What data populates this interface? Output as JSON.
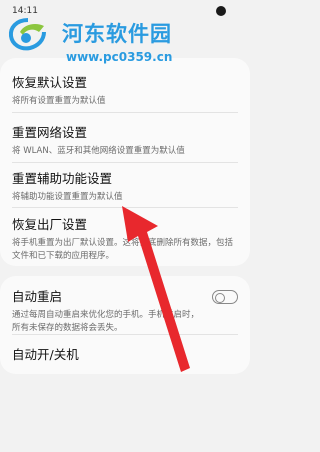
{
  "status": {
    "time": "14:11"
  },
  "watermark": {
    "title": "河东软件园",
    "url": "www.pc0359.cn"
  },
  "settings": {
    "reset_all": {
      "title": "恢复默认设置",
      "desc": "将所有设置重置为默认值"
    },
    "reset_network": {
      "title": "重置网络设置",
      "desc": "将 WLAN、蓝牙和其他网络设置重置为默认值"
    },
    "reset_accessibility": {
      "title": "重置辅助功能设置",
      "desc": "将辅助功能设置重置为默认值"
    },
    "factory_reset": {
      "title": "恢复出厂设置",
      "desc": "将手机重置为出厂默认设置。这将彻底删除所有数据，包括文件和已下载的应用程序。"
    },
    "auto_restart": {
      "title": "自动重启",
      "desc": "通过每周自动重启来优化您的手机。手机重启时，所有未保存的数据将会丢失。",
      "enabled": false
    },
    "auto_power": {
      "title": "自动开/关机"
    }
  },
  "colors": {
    "watermark": "#2a9be0",
    "arrow": "#e8282d"
  }
}
